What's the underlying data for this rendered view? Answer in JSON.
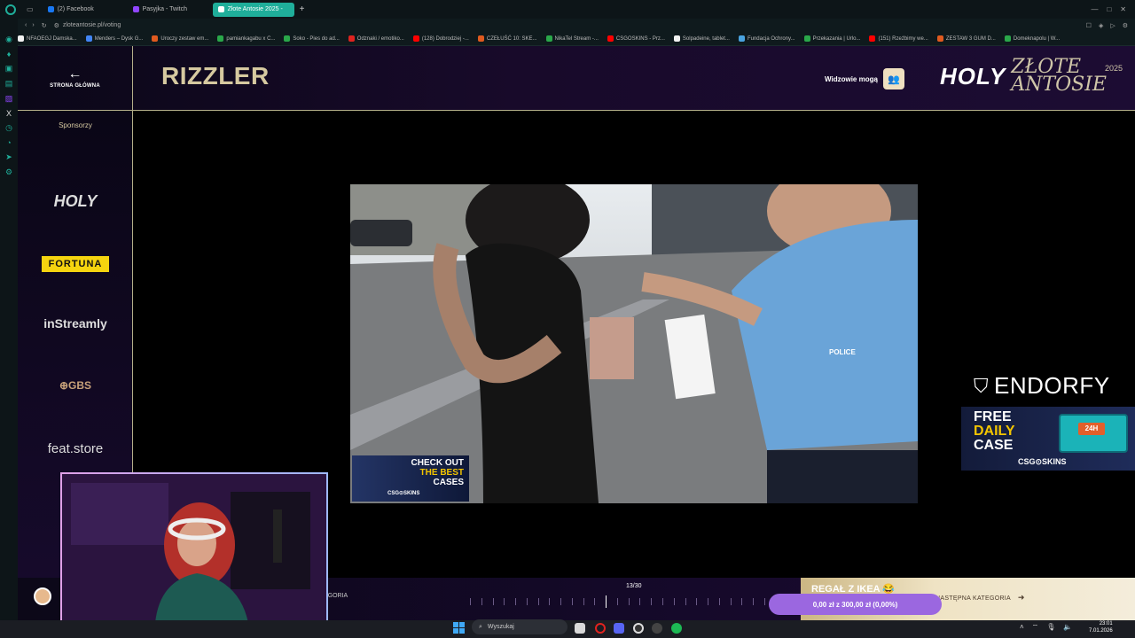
{
  "browser": {
    "tabs": [
      {
        "label": "(2) Facebook",
        "color": "#1877f2",
        "active": false
      },
      {
        "label": "Pasyjka - Twitch",
        "color": "#9146ff",
        "active": false
      },
      {
        "label": "Złote Antosie 2025 - ",
        "color": "#ffffff",
        "active": true
      }
    ],
    "url": "zloteantosie.pl/voting",
    "bookmarks": [
      {
        "label": "NFAOEGJ Damska...",
        "color": "#f2f2f2"
      },
      {
        "label": "Menders – Dysk G...",
        "color": "#4285f4"
      },
      {
        "label": "Uroczy zestaw em...",
        "color": "#e05a1f"
      },
      {
        "label": "pamiankagabu x C...",
        "color": "#2aa84a"
      },
      {
        "label": "Soko - Pies do ad...",
        "color": "#2aa84a"
      },
      {
        "label": "Odznaki / emotiko...",
        "color": "#e0231f"
      },
      {
        "label": "(128) Dobrodziej -...",
        "color": "#ff0000"
      },
      {
        "label": "CZEŁUŚĆ 10: SKE...",
        "color": "#e05a1f"
      },
      {
        "label": "NikaTel Stream -...",
        "color": "#2aa84a"
      },
      {
        "label": "CSGOSKINS - Prz...",
        "color": "#ff0000"
      },
      {
        "label": "Solpadeine, tablet...",
        "color": "#f2f2f2"
      },
      {
        "label": "Fundacja Ochrony...",
        "color": "#4aa3df"
      },
      {
        "label": "Przekazania | Urlo...",
        "color": "#2aa84a"
      },
      {
        "label": "(151) Rzeźbimy we...",
        "color": "#ff0000"
      },
      {
        "label": "ZESTAW 3 GUM D...",
        "color": "#e05a1f"
      },
      {
        "label": "Domeknapolu | W...",
        "color": "#2aa84a"
      }
    ]
  },
  "page": {
    "back_label": "STRONA GŁÓWNA",
    "title": "RIZZLER",
    "viewers_label": "Widzowie mogą",
    "logo_holy": "HOLY",
    "logo_line1": "ZŁOTE",
    "logo_line2": "ANTOSIE",
    "logo_year": "2025",
    "sponsors_label": "Sponsorzy",
    "sponsors": [
      "HOLY",
      "FORTUNA",
      "inStreamly",
      "GBS",
      "feat.store"
    ],
    "video_promo": {
      "line1": "CHECK OUT",
      "line2": "THE BEST",
      "line3": "CASES",
      "brand": "CSG⊙SKINS"
    },
    "endorfy": "ENDORFY",
    "csgo_ad": {
      "line1": "FREE",
      "line2": "DAILY",
      "line3": "CASE",
      "brand": "CSG⊙SKINS",
      "chest": "24H"
    },
    "progress": {
      "label": "13/30",
      "current": 13,
      "total": 30
    },
    "category_left": "EGORIA",
    "prize_name": "REGAŁ Z IKEA 😂",
    "next_category": "NASTĘPNA KATEGORIA",
    "donation": "0,00 zł z 300,00 zł (0,00%)"
  },
  "taskbar": {
    "search_placeholder": "Wyszukaj",
    "time": "23:01",
    "date": "7.01.2026"
  }
}
